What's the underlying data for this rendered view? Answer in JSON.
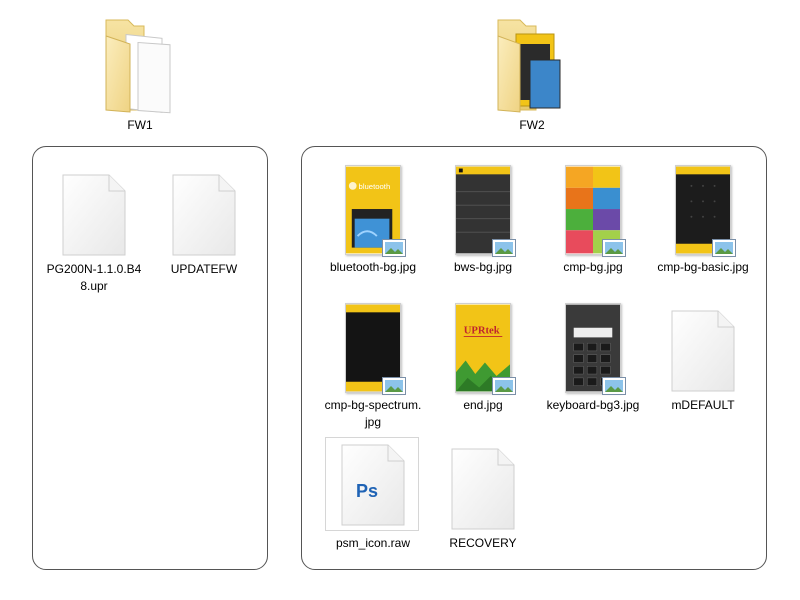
{
  "folders": [
    {
      "label": "FW1"
    },
    {
      "label": "FW2"
    }
  ],
  "fw1_items": [
    {
      "name": "PG200N-1.1.0.B48.upr",
      "icon": "blank-file-icon"
    },
    {
      "name": "UPDATEFW",
      "icon": "blank-file-icon"
    }
  ],
  "fw2_items": [
    {
      "name": "bluetooth-bg.jpg",
      "icon": "image-thumbnail-icon"
    },
    {
      "name": "bws-bg.jpg",
      "icon": "image-thumbnail-icon"
    },
    {
      "name": "cmp-bg.jpg",
      "icon": "image-thumbnail-icon"
    },
    {
      "name": "cmp-bg-basic.jpg",
      "icon": "image-thumbnail-icon"
    },
    {
      "name": "cmp-bg-spectrum.jpg",
      "icon": "image-thumbnail-icon"
    },
    {
      "name": "end.jpg",
      "icon": "image-thumbnail-icon"
    },
    {
      "name": "keyboard-bg3.jpg",
      "icon": "image-thumbnail-icon"
    },
    {
      "name": "mDEFAULT",
      "icon": "blank-file-icon"
    },
    {
      "name": "psm_icon.raw",
      "icon": "photoshop-file-icon"
    },
    {
      "name": "RECOVERY",
      "icon": "blank-file-icon"
    }
  ],
  "thumb_text": {
    "bluetooth": "bluetooth",
    "end_logo": "UPRtek",
    "ps": "Ps"
  },
  "colors": {
    "folder_yellow": "#f3d98a",
    "accent_yellow": "#f2c417",
    "dark_screen": "#2a2a2a",
    "panel_border": "#555555"
  }
}
